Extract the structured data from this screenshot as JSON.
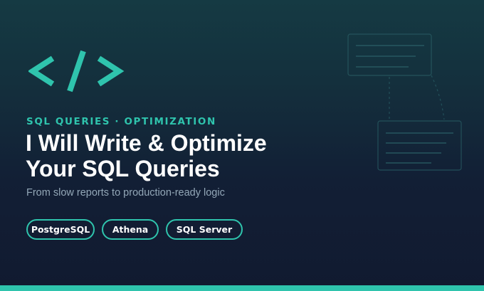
{
  "banner": {
    "logo_icon": "code-brackets-icon",
    "eyebrow": "SQL QUERIES · OPTIMIZATION",
    "title_lines": [
      "I Will Write & Optimize",
      "Your SQL Queries"
    ],
    "subtitle": "From slow reports to production-ready logic",
    "tags": [
      {
        "label": "PostgreSQL"
      },
      {
        "label": "Athena"
      },
      {
        "label": "SQL Server"
      }
    ],
    "decoration_icon": "database-flow-diagram-icon"
  },
  "colors": {
    "accent": "#2fc4ad",
    "background_top": "#153a43",
    "background_bottom": "#111a30",
    "title": "#ffffff",
    "subtitle": "#93a7b7"
  }
}
